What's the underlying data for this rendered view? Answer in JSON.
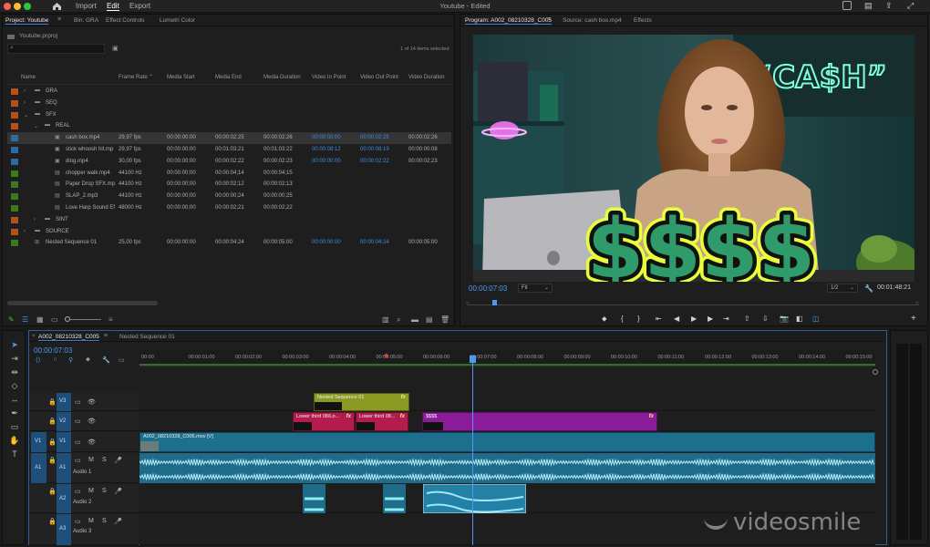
{
  "app": {
    "window_title": "Youtube - Edited",
    "menu": [
      {
        "label": "Import"
      },
      {
        "label": "Edit"
      },
      {
        "label": "Export"
      }
    ]
  },
  "project_panel": {
    "tabs": [
      {
        "label": "Project: Youtube"
      },
      {
        "label": "Bin: GRA"
      },
      {
        "label": "Effect Controls"
      },
      {
        "label": "Lumetri Color"
      }
    ],
    "breadcrumb": "Youtube.prproj",
    "items_selected": "1 of 14 items selected",
    "columns": [
      "Name",
      "Frame Rate",
      "Media Start",
      "Media End",
      "Media Duration",
      "Video In Point",
      "Video Out Point",
      "Video Duration"
    ],
    "rows": [
      {
        "name": "GRA",
        "type": "folder",
        "color": "#b8501e",
        "indent": 0,
        "rate": "",
        "start": "",
        "end": "",
        "dur": "",
        "vin": "",
        "vout": "",
        "vdur": ""
      },
      {
        "name": "SEQ",
        "type": "folder",
        "color": "#b8501e",
        "indent": 0,
        "rate": "",
        "start": "",
        "end": "",
        "dur": "",
        "vin": "",
        "vout": "",
        "vdur": ""
      },
      {
        "name": "SFX",
        "type": "folder-open",
        "color": "#b8501e",
        "indent": 0,
        "rate": "",
        "start": "",
        "end": "",
        "dur": "",
        "vin": "",
        "vout": "",
        "vdur": ""
      },
      {
        "name": "REAL",
        "type": "folder-open",
        "color": "#b8501e",
        "indent": 1,
        "rate": "",
        "start": "",
        "end": "",
        "dur": "",
        "vin": "",
        "vout": "",
        "vdur": ""
      },
      {
        "name": "cash box.mp4",
        "type": "video",
        "color": "#2c6aa0",
        "indent": 2,
        "rate": "29,97 fps",
        "start": "00:00:00:00",
        "end": "00:00:02:25",
        "dur": "00:00:02:26",
        "vin": "00:00:00:00",
        "vout": "00:00:02:25",
        "vdur": "00:00:02:26",
        "selected": true
      },
      {
        "name": "stick whoosh hit.mp",
        "type": "video",
        "color": "#2c6aa0",
        "indent": 2,
        "rate": "29,97 fps",
        "start": "00:00:00:00",
        "end": "00:01:03:21",
        "dur": "00:01:03:22",
        "vin": "00:00:08:12",
        "vout": "00:00:08:19",
        "vdur": "00:00:00:08"
      },
      {
        "name": "ding.mp4",
        "type": "video",
        "color": "#2c6aa0",
        "indent": 2,
        "rate": "30,00 fps",
        "start": "00:00:00:00",
        "end": "00:00:02:22",
        "dur": "00:00:02:23",
        "vin": "00:00:00:00",
        "vout": "00:00:02:22",
        "vdur": "00:00:02:23"
      },
      {
        "name": "chopper walk.mp4",
        "type": "audio",
        "color": "#3b7a1e",
        "indent": 2,
        "rate": "44100 Hz",
        "start": "00:00:00;00",
        "end": "00:00:04;14",
        "dur": "00:00:04;15",
        "vin": "",
        "vout": "",
        "vdur": ""
      },
      {
        "name": "Paper Drop SFX.mp",
        "type": "audio",
        "color": "#3b7a1e",
        "indent": 2,
        "rate": "44100 Hz",
        "start": "00:00:00;00",
        "end": "00:00:02;12",
        "dur": "00:00:02;13",
        "vin": "",
        "vout": "",
        "vdur": ""
      },
      {
        "name": "SLAP_2.mp3",
        "type": "audio",
        "color": "#3b7a1e",
        "indent": 2,
        "rate": "44100 Hz",
        "start": "00:00:00;00",
        "end": "00:00:00;24",
        "dur": "00:00:00;25",
        "vin": "",
        "vout": "",
        "vdur": ""
      },
      {
        "name": "Love Harp Sound Ef",
        "type": "audio",
        "color": "#3b7a1e",
        "indent": 2,
        "rate": "48000 Hz",
        "start": "00:00:00;00",
        "end": "00:00:02;21",
        "dur": "00:00:02;22",
        "vin": "",
        "vout": "",
        "vdur": ""
      },
      {
        "name": "SINT",
        "type": "folder",
        "color": "#b8501e",
        "indent": 1,
        "rate": "",
        "start": "",
        "end": "",
        "dur": "",
        "vin": "",
        "vout": "",
        "vdur": ""
      },
      {
        "name": "SOURCE",
        "type": "folder",
        "color": "#b8501e",
        "indent": 0,
        "rate": "",
        "start": "",
        "end": "",
        "dur": "",
        "vin": "",
        "vout": "",
        "vdur": ""
      },
      {
        "name": "Nested Sequence 01",
        "type": "sequence",
        "color": "#3b7a1e",
        "indent": 0,
        "rate": "25,00 fps",
        "start": "00:00:00:00",
        "end": "00:00:04:24",
        "dur": "00:00:05:00",
        "vin": "00:00:00:00",
        "vout": "00:00:04:24",
        "vdur": "00:00:05:00"
      }
    ]
  },
  "program_monitor": {
    "tabs": [
      {
        "label": "Program: A002_08210328_C005"
      },
      {
        "label": "Source: cash box.mp4"
      },
      {
        "label": "Effects"
      }
    ],
    "neon_text": "“CA$H”",
    "overlay_text": "$$$$",
    "timecode": "00:00:07:03",
    "fit": "Fit",
    "resolution": "1/2",
    "duration": "00:01:48:21"
  },
  "timeline": {
    "tabs": [
      {
        "label": "A002_08210328_C005"
      },
      {
        "label": "Nested Sequence 01"
      }
    ],
    "timecode": "00:00:07:03",
    "ruler": [
      "00:00",
      "00:00:01:00",
      "00:00:02:00",
      "00:00:03:00",
      "00:00:04:00",
      "00:00:05:00",
      "00:00:06:00",
      "00:00:07:00",
      "00:00:08:00",
      "00:00:09:00",
      "00:00:10:00",
      "00:00:11:00",
      "00:00:12:00",
      "00:00:13:00",
      "00:00:14:00",
      "00:00:15:00"
    ],
    "tracks": {
      "v3": "V3",
      "v2": "V2",
      "v1": "V1",
      "a1": "A1",
      "a2": "A2",
      "a3": "A3",
      "src_v1": "V1",
      "src_a1": "A1",
      "audio1": "Audio 1",
      "audio2": "Audio 2",
      "audio3": "Audio 3"
    },
    "clips": {
      "nested": "Nested Sequence 01",
      "lower1": "Lower third 08/Lo...",
      "lower2": "Lower third 08...",
      "dollars": "$$$$",
      "main": "A002_08210328_C005.mov [V]"
    },
    "fx_label": "fx"
  },
  "watermark": "videosmile"
}
